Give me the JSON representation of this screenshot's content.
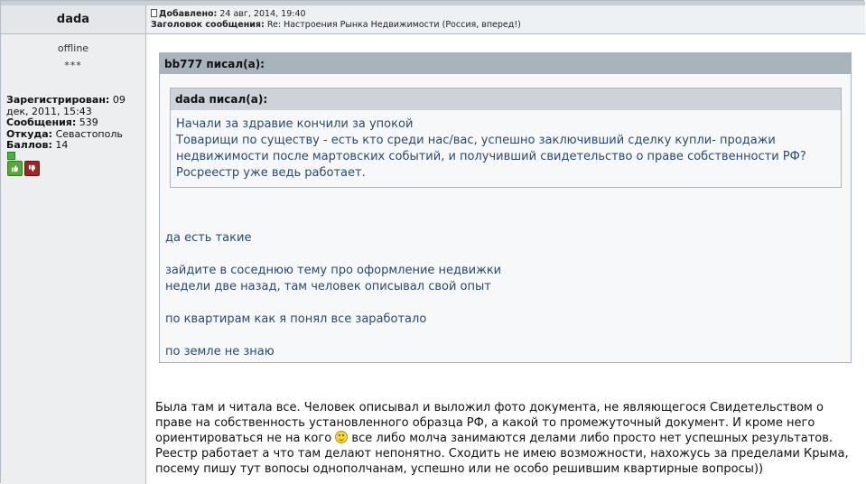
{
  "author": {
    "name": "dada",
    "status": "offline",
    "rank": "***",
    "registered_label": "Зарегистрирован:",
    "registered_value": "09 дек, 2011, 15:43",
    "posts_label": "Сообщения:",
    "posts_value": "539",
    "from_label": "Откуда:",
    "from_value": "Севастополь",
    "points_label": "Баллов:",
    "points_value": "14",
    "vote_up_icon": "thumbs-up-icon",
    "vote_down_icon": "thumbs-down-icon"
  },
  "meta": {
    "added_label": "Добавлено:",
    "added_value": "24 авг, 2014, 19:40",
    "subject_label": "Заголовок сообщения:",
    "subject_value": "Re: Настроения Рынка Недвижимости (Россия, вперед!)"
  },
  "quote_outer": {
    "header": "bb777 писал(а):",
    "paragraphs": [
      "да есть такие",
      "зайдите в соседнюю тему про оформление недвижки\nнедели две назад, там человек описывал свой опыт",
      "по квартирам как я понял все заработало",
      "по земле не знаю"
    ]
  },
  "quote_inner": {
    "header": "dada писал(а):",
    "lines": [
      "Начали за здравие кончили за упокой",
      "Товарищи по существу - есть кто среди нас/вас, успешно заключивший сделку купли- продажи",
      "недвижимости после мартовских событий, и получивший свидетельство о праве собственности РФ?",
      "Росреестр уже ведь работает."
    ]
  },
  "body": {
    "part1": "Была там и читала все. Человек описывал и выложил фото документа, не являющегося Свидетельством о праве на собственность установленного образца РФ, а какой то промежуточный документ. И кроме него ориентироваться не на кого ",
    "smiley_icon": "smiley-icon",
    "part2": " все либо молча занимаются делами либо просто нет успешных результатов. Реестр работает а что там делают непонятно. Сходить не имею возможности, нахожусь за пределами Крыма, посему пишу тут вопосы однополчанам, успешно или не особо решившим квартирные вопросы))"
  },
  "colors": {
    "quote_text": "#2c4a6a",
    "quote_header_outer": "#a9b3bc",
    "quote_header_inner": "#cdd3d8",
    "author_bg": "#eceeef"
  }
}
